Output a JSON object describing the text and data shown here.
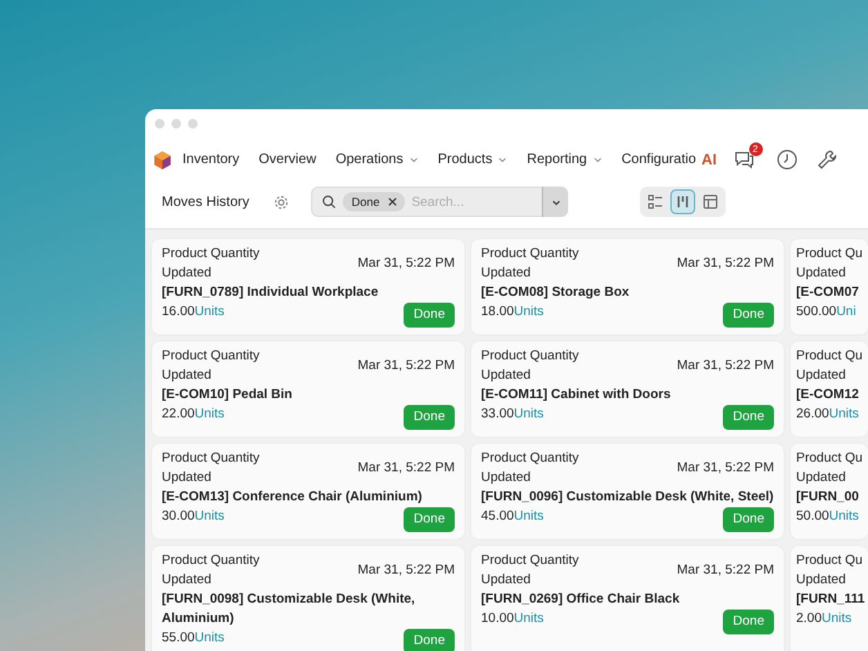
{
  "nav": {
    "app": "Inventory",
    "items": [
      {
        "label": "Overview",
        "dropdown": false
      },
      {
        "label": "Operations",
        "dropdown": true
      },
      {
        "label": "Products",
        "dropdown": true
      },
      {
        "label": "Reporting",
        "dropdown": true
      },
      {
        "label": "Configuratio",
        "dropdown": false
      }
    ],
    "ai_label": "AI",
    "messages_badge": "2"
  },
  "toolbar": {
    "title": "Moves History",
    "search": {
      "facet": "Done",
      "placeholder": "Search..."
    },
    "views": [
      {
        "kind": "list",
        "selected": false
      },
      {
        "kind": "kanban",
        "selected": true
      },
      {
        "kind": "table",
        "selected": false
      }
    ]
  },
  "cards": [
    {
      "title": "Product Quantity Updated",
      "date": "Mar 31, 5:22 PM",
      "product": "[FURN_0789] Individual Workplace",
      "quantity": "16.00",
      "unit": "Units",
      "status": "Done"
    },
    {
      "title": "Product Quantity Updated",
      "date": "Mar 31, 5:22 PM",
      "product": "[E-COM08] Storage Box",
      "quantity": "18.00",
      "unit": "Units",
      "status": "Done"
    },
    {
      "title": "Product Qu",
      "title_2": "Updated",
      "product": "[E-COM07",
      "quantity": "500.00",
      "unit": "Uni"
    },
    {
      "title": "Product Quantity Updated",
      "date": "Mar 31, 5:22 PM",
      "product": "[E-COM10] Pedal Bin",
      "quantity": "22.00",
      "unit": "Units",
      "status": "Done"
    },
    {
      "title": "Product Quantity Updated",
      "date": "Mar 31, 5:22 PM",
      "product": "[E-COM11] Cabinet with Doors",
      "quantity": "33.00",
      "unit": "Units",
      "status": "Done"
    },
    {
      "title": "Product Qu",
      "title_2": "Updated",
      "product": "[E-COM12",
      "quantity": "26.00",
      "unit": "Units"
    },
    {
      "title": "Product Quantity Updated",
      "date": "Mar 31, 5:22 PM",
      "product": "[E-COM13] Conference Chair (Aluminium)",
      "quantity": "30.00",
      "unit": "Units",
      "status": "Done"
    },
    {
      "title": "Product Quantity Updated",
      "date": "Mar 31, 5:22 PM",
      "product": "[FURN_0096] Customizable Desk (White, Steel)",
      "quantity": "45.00",
      "unit": "Units",
      "status": "Done"
    },
    {
      "title": "Product Qu",
      "title_2": "Updated",
      "product": "[FURN_00",
      "quantity": "50.00",
      "unit": "Units"
    },
    {
      "title": "Product Quantity Updated",
      "date": "Mar 31, 5:22 PM",
      "product": "[FURN_0098] Customizable Desk (White, Aluminium)",
      "quantity": "55.00",
      "unit": "Units",
      "status": "Done"
    },
    {
      "title": "Product Quantity Updated",
      "date": "Mar 31, 5:22 PM",
      "product": "[FURN_0269] Office Chair Black",
      "quantity": "10.00",
      "unit": "Units",
      "status": "Done"
    },
    {
      "title": "Product Qu",
      "title_2": "Updated",
      "product": "[FURN_111",
      "quantity": "2.00",
      "unit": "Units"
    }
  ]
}
